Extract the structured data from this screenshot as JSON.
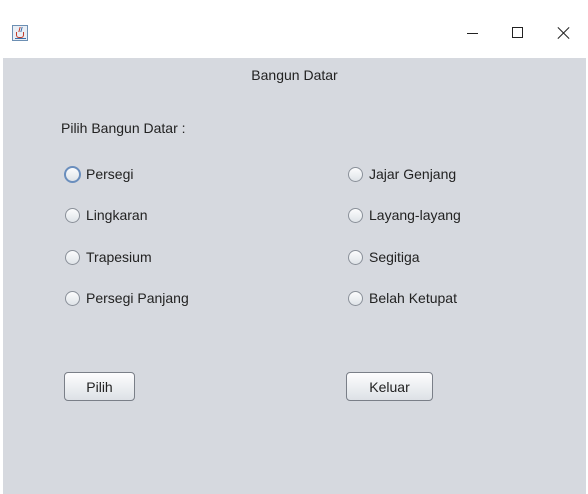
{
  "window": {
    "icon": "java-cup-icon",
    "controls": [
      "minimize-icon",
      "maximize-icon",
      "close-icon"
    ]
  },
  "header": {
    "title": "Bangun Datar"
  },
  "form": {
    "prompt": "Pilih Bangun Datar :",
    "left_options": [
      "Persegi",
      "Lingkaran",
      "Trapesium",
      "Persegi Panjang"
    ],
    "right_options": [
      "Jajar Genjang",
      "Layang-layang",
      "Segitiga",
      "Belah Ketupat"
    ]
  },
  "buttons": {
    "pilih": "Pilih",
    "keluar": "Keluar"
  },
  "colors": {
    "panel": "#d6d9df",
    "focus": "#6a8ebd",
    "text": "#222222"
  }
}
